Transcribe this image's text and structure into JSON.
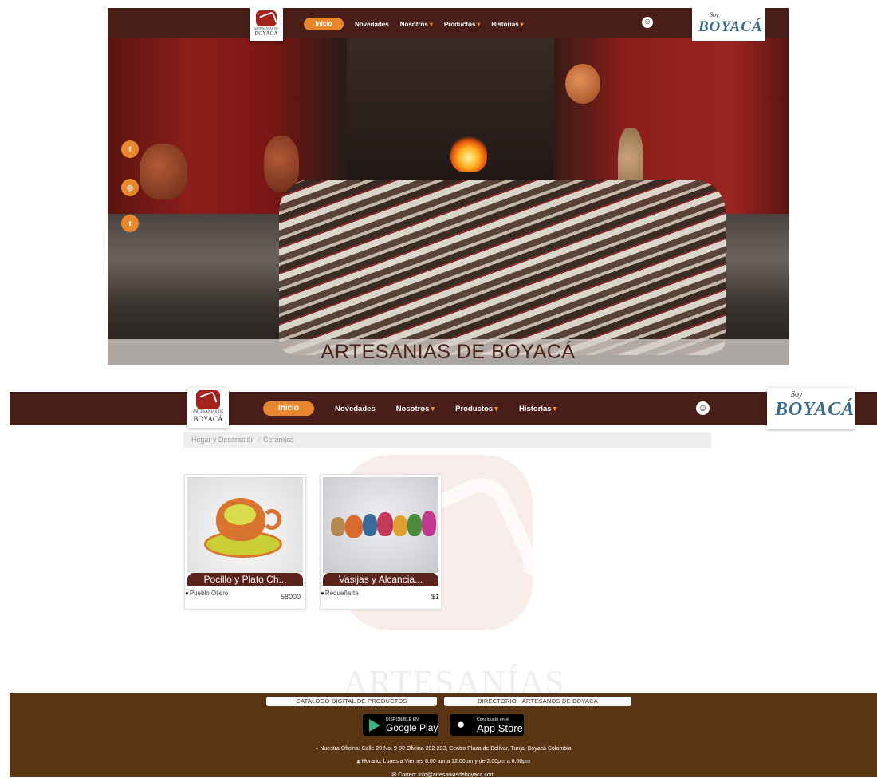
{
  "top_nav": {
    "logo_line1": "ARTESANIAS DE",
    "logo_line2": "BOYACÁ",
    "menu": [
      {
        "label": "Inicio"
      },
      {
        "label": "Novedades"
      },
      {
        "label": "Nosotros"
      },
      {
        "label": "Productos"
      },
      {
        "label": "Historias"
      }
    ],
    "brand_small": "Soy",
    "brand_big": "BOYACÁ"
  },
  "hero": {
    "social": [
      "facebook-icon",
      "instagram-icon",
      "twitter-icon"
    ],
    "title": "ARTESANIAS DE BOYACÁ"
  },
  "breadcrumb": {
    "items": [
      "Hogar y Decoración",
      "Cerámica"
    ]
  },
  "watermark_text": "ARTESANÍAS",
  "products": [
    {
      "title": "Pocillo y Plato Ch...",
      "seller": "Pueblo Ollero",
      "price": "58000"
    },
    {
      "title": "Vasijas y Alcancia...",
      "seller": "Requeñarte",
      "price": "$1"
    }
  ],
  "footer": {
    "btn_catalog": "CATALOGO DIGITAL DE PRODUCTOS",
    "btn_directory": "DIRECTORIO - ARTESANOS DE BOYACÁ",
    "google_small": "DISPONIBLE EN",
    "google_big": "Google Play",
    "apple_small": "Consíguelo en el",
    "apple_big": "App Store",
    "office": "Nuestra Oficina: Calle 20 No. 9-90 Oficina 202-203, Centro Plaza de Bolívar, Tunja, Boyacá Colombia",
    "hours": "Horario: Lunes a Viernes 8:00 am a 12:00pm y de 2:00pm a 6:00pm",
    "email": "Correo: info@artesaniasdeboyaca.com"
  },
  "colors": {
    "nav_bg": "#4a1e18",
    "accent": "#e8882e",
    "footer_bg": "#5a3514"
  }
}
